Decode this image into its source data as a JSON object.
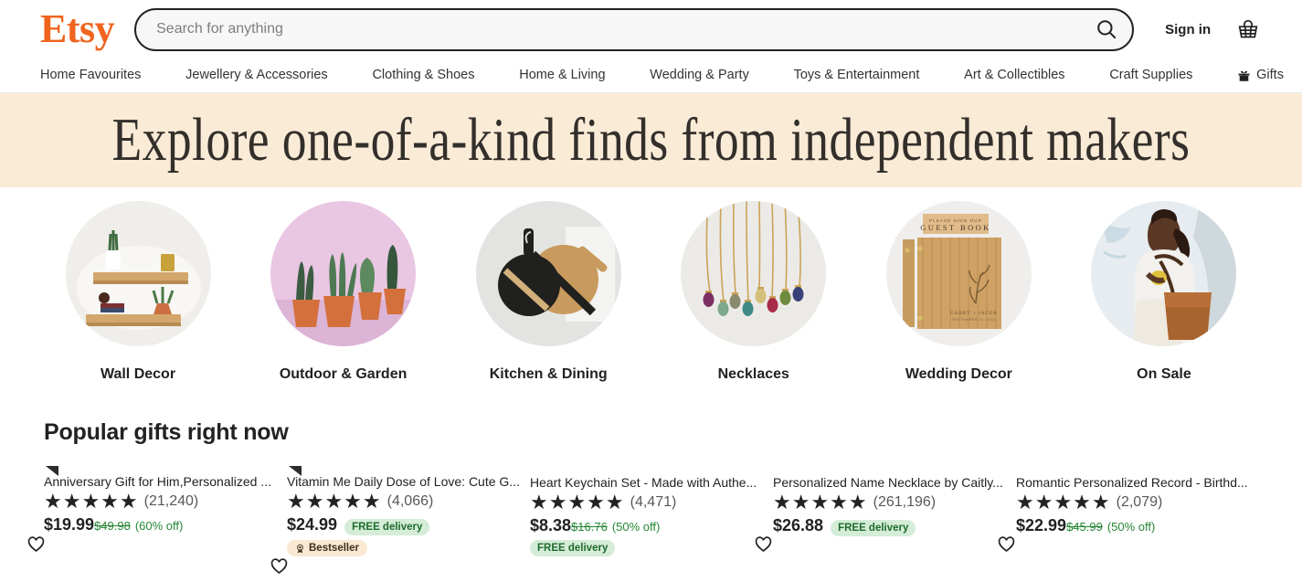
{
  "header": {
    "logo_text": "Etsy",
    "logo_color": "#F1641E",
    "search": {
      "placeholder": "Search for anything",
      "value": "",
      "icon": "search-icon"
    },
    "sign_in_label": "Sign in",
    "cart_icon": "shopping-basket-icon"
  },
  "nav": {
    "items": [
      {
        "label": "Home Favourites",
        "icon": null
      },
      {
        "label": "Jewellery & Accessories",
        "icon": null
      },
      {
        "label": "Clothing & Shoes",
        "icon": null
      },
      {
        "label": "Home & Living",
        "icon": null
      },
      {
        "label": "Wedding & Party",
        "icon": null
      },
      {
        "label": "Toys & Entertainment",
        "icon": null
      },
      {
        "label": "Art & Collectibles",
        "icon": null
      },
      {
        "label": "Craft Supplies",
        "icon": null
      },
      {
        "label": "Gifts",
        "icon": "gift-box-icon"
      }
    ]
  },
  "banner": {
    "text": "Explore one-of-a-kind finds from independent makers",
    "background_color": "#FAEBD7",
    "text_color": "#332F2B"
  },
  "categories": [
    {
      "label": "Wall Decor",
      "image": "floating-wood-shelves-with-plants"
    },
    {
      "label": "Outdoor & Garden",
      "image": "potted-succulents-on-pink-background"
    },
    {
      "label": "Kitchen & Dining",
      "image": "wood-and-black-cutting-boards"
    },
    {
      "label": "Necklaces",
      "image": "gemstone-pendant-necklaces-on-marble"
    },
    {
      "label": "Wedding Decor",
      "image": "engraved-wooden-guest-book"
    },
    {
      "label": "On Sale",
      "image": "woman-with-brown-leather-tote-bag"
    }
  ],
  "popular_section": {
    "title": "Popular gifts right now",
    "products": [
      {
        "title": "Anniversary Gift for Him,Personalized ...",
        "stars": 5,
        "review_count": "(21,240)",
        "price": "$19.99",
        "original_price": "$49.98",
        "discount": "(60% off)",
        "free_delivery": null,
        "bestseller": null,
        "favorite_icon": "heart-icon"
      },
      {
        "title": "Vitamin Me Daily Dose of Love: Cute G...",
        "stars": 5,
        "review_count": "(4,066)",
        "price": "$24.99",
        "original_price": null,
        "discount": null,
        "free_delivery": "FREE delivery",
        "bestseller": "Bestseller",
        "favorite_icon": "heart-icon"
      },
      {
        "title": "Heart Keychain Set - Made with Authe...",
        "stars": 5,
        "review_count": "(4,471)",
        "price": "$8.38",
        "original_price": "$16.76",
        "discount": "(50% off)",
        "free_delivery": "FREE delivery",
        "bestseller": null,
        "favorite_icon": "heart-icon"
      },
      {
        "title": "Personalized Name Necklace by Caitly...",
        "stars": 5,
        "review_count": "(261,196)",
        "price": "$26.88",
        "original_price": null,
        "discount": null,
        "free_delivery": "FREE delivery",
        "bestseller": null,
        "favorite_icon": "heart-icon"
      },
      {
        "title": "Romantic Personalized Record - Birthd...",
        "stars": 5,
        "review_count": "(2,079)",
        "price": "$22.99",
        "original_price": "$45.99",
        "discount": "(50% off)",
        "free_delivery": null,
        "bestseller": null,
        "favorite_icon": "heart-icon"
      }
    ],
    "star_glyph": "★",
    "colors": {
      "sale_green": "#258635",
      "free_delivery_bg": "#D4ECD8",
      "bestseller_bg": "#FAE8D2"
    }
  }
}
